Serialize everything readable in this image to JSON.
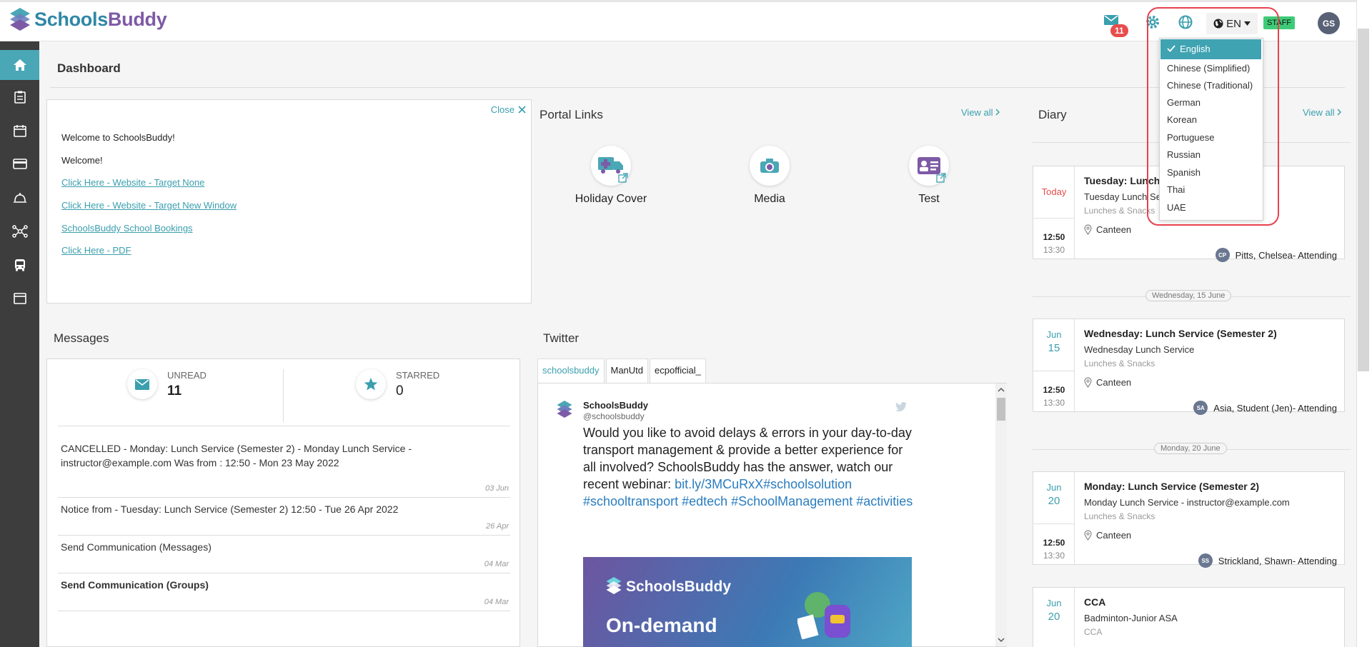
{
  "brand": {
    "part1": "Schools",
    "part2": "Buddy"
  },
  "header": {
    "mail_count": "11",
    "lang": "EN",
    "staff_badge": "STAFF",
    "avatar_initials": "GS"
  },
  "page_title": "Dashboard",
  "welcome": {
    "close_label": "Close",
    "line1": "Welcome to SchoolsBuddy!",
    "line2": "Welcome!",
    "links": [
      "Click Here - Website - Target None",
      "Click Here - Website - Target New Window",
      "SchoolsBuddy School Bookings",
      "Click Here - PDF"
    ]
  },
  "portal": {
    "title": "Portal Links",
    "view_all": "View all",
    "items": [
      {
        "label": "Holiday Cover"
      },
      {
        "label": "Media"
      },
      {
        "label": "Test"
      }
    ]
  },
  "messages": {
    "title": "Messages",
    "unread_label": "UNREAD",
    "unread_count": "11",
    "starred_label": "STARRED",
    "starred_count": "0",
    "rows": [
      {
        "text": "CANCELLED - Monday: Lunch Service (Semester 2) - Monday Lunch Service - instructor@example.com Was from : 12:50 - Mon 23 May 2022",
        "date": "03 Jun"
      },
      {
        "text": "Notice from - Tuesday: Lunch Service (Semester 2) 12:50 - Tue 26 Apr 2022",
        "date": "26 Apr"
      },
      {
        "text": "Send Communication (Messages)",
        "date": "04 Mar"
      },
      {
        "text": "Send Communication (Groups)",
        "date": "04 Mar"
      }
    ]
  },
  "twitter": {
    "title": "Twitter",
    "tabs": [
      "schoolsbuddy",
      "ManUtd",
      "ecpofficial_"
    ],
    "tweet": {
      "name": "SchoolsBuddy",
      "handle": "@schoolsbuddy",
      "text": "Would you like to avoid delays & errors in your day-to-day transport management & provide a better experience for all involved? SchoolsBuddy has the answer, watch our recent webinar: ",
      "links": "bit.ly/3MCuRxX#schoolsolution #schooltransport #edtech #SchoolManagement #activities",
      "image_brand": "SchoolsBuddy",
      "image_text": "On-demand"
    }
  },
  "diary": {
    "title": "Diary",
    "view_all": "View all",
    "day_labels": [
      "Wednesday, 15 June",
      "Monday, 20 June"
    ],
    "events": [
      {
        "day": "Today",
        "month": "",
        "title": "Tuesday: Lunch Service (Semester 2)",
        "subtitle": "Tuesday Lunch Service",
        "category": "Lunches & Snacks",
        "location": "Canteen",
        "start": "12:50",
        "end": "13:30",
        "attendee_initials": "CP",
        "attendee": "Pitts, Chelsea- Attending"
      },
      {
        "day": "15",
        "month": "Jun",
        "title": "Wednesday: Lunch Service (Semester 2)",
        "subtitle": "Wednesday Lunch Service",
        "category": "Lunches & Snacks",
        "location": "Canteen",
        "start": "12:50",
        "end": "13:30",
        "attendee_initials": "SA",
        "attendee": "Asia, Student (Jen)- Attending"
      },
      {
        "day": "20",
        "month": "Jun",
        "title": "Monday: Lunch Service (Semester 2)",
        "subtitle": "Monday Lunch Service - instructor@example.com",
        "category": "Lunches & Snacks",
        "location": "Canteen",
        "start": "12:50",
        "end": "13:30",
        "attendee_initials": "SS",
        "attendee": "Strickland, Shawn- Attending"
      },
      {
        "day": "20",
        "month": "Jun",
        "title": "CCA",
        "subtitle": "Badminton-Junior ASA",
        "category": "CCA"
      }
    ]
  },
  "languages": {
    "selected": "English",
    "options": [
      "Chinese (Simplified)",
      "Chinese (Traditional)",
      "German",
      "Korean",
      "Portuguese",
      "Russian",
      "Spanish",
      "Thai",
      "UAE"
    ]
  },
  "colors": {
    "accent": "#3fa3b2",
    "sidebar": "#3d3d3d",
    "alert": "#e84c4c",
    "highlight": "#e8414e"
  }
}
